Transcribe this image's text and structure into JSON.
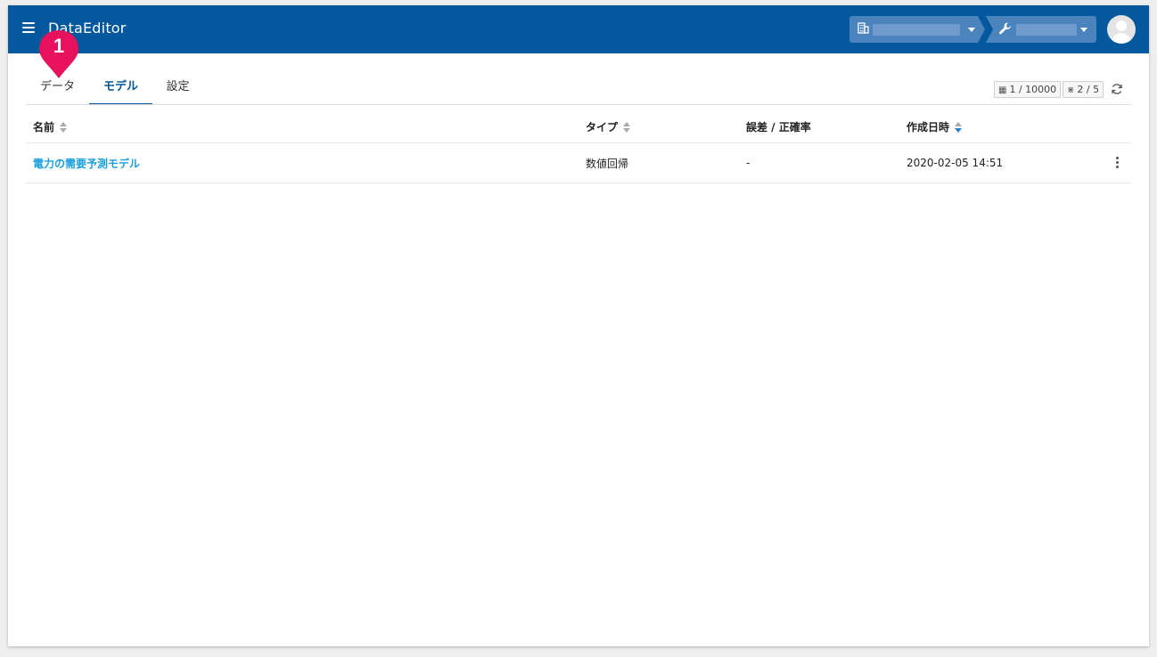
{
  "app": {
    "title": "DataEditor"
  },
  "header": {
    "org_selector": {
      "icon": "building-icon",
      "value": ""
    },
    "project_selector": {
      "icon": "wrench-icon",
      "value": ""
    }
  },
  "badge": {
    "number": "1",
    "color": "#e8125c"
  },
  "tabs": [
    {
      "label": "データ",
      "active": false
    },
    {
      "label": "モデル",
      "active": true
    },
    {
      "label": "設定",
      "active": false
    }
  ],
  "quota": {
    "rows": "1 / 10000",
    "models": "2 / 5"
  },
  "table": {
    "columns": [
      {
        "label": "名前",
        "sortable": true,
        "sort_active": false
      },
      {
        "label": "タイプ",
        "sortable": true,
        "sort_active": false
      },
      {
        "label": "誤差 / 正確率",
        "sortable": false,
        "sort_active": false
      },
      {
        "label": "作成日時",
        "sortable": true,
        "sort_active": true,
        "sort_direction": "desc"
      }
    ],
    "rows": [
      {
        "name": "電力の需要予測モデル",
        "type": "数値回帰",
        "metric": "-",
        "created": "2020-02-05 14:51"
      }
    ]
  },
  "colors": {
    "appbar": "#04589d",
    "accent": "#04589d",
    "link": "#1a9fdb"
  }
}
